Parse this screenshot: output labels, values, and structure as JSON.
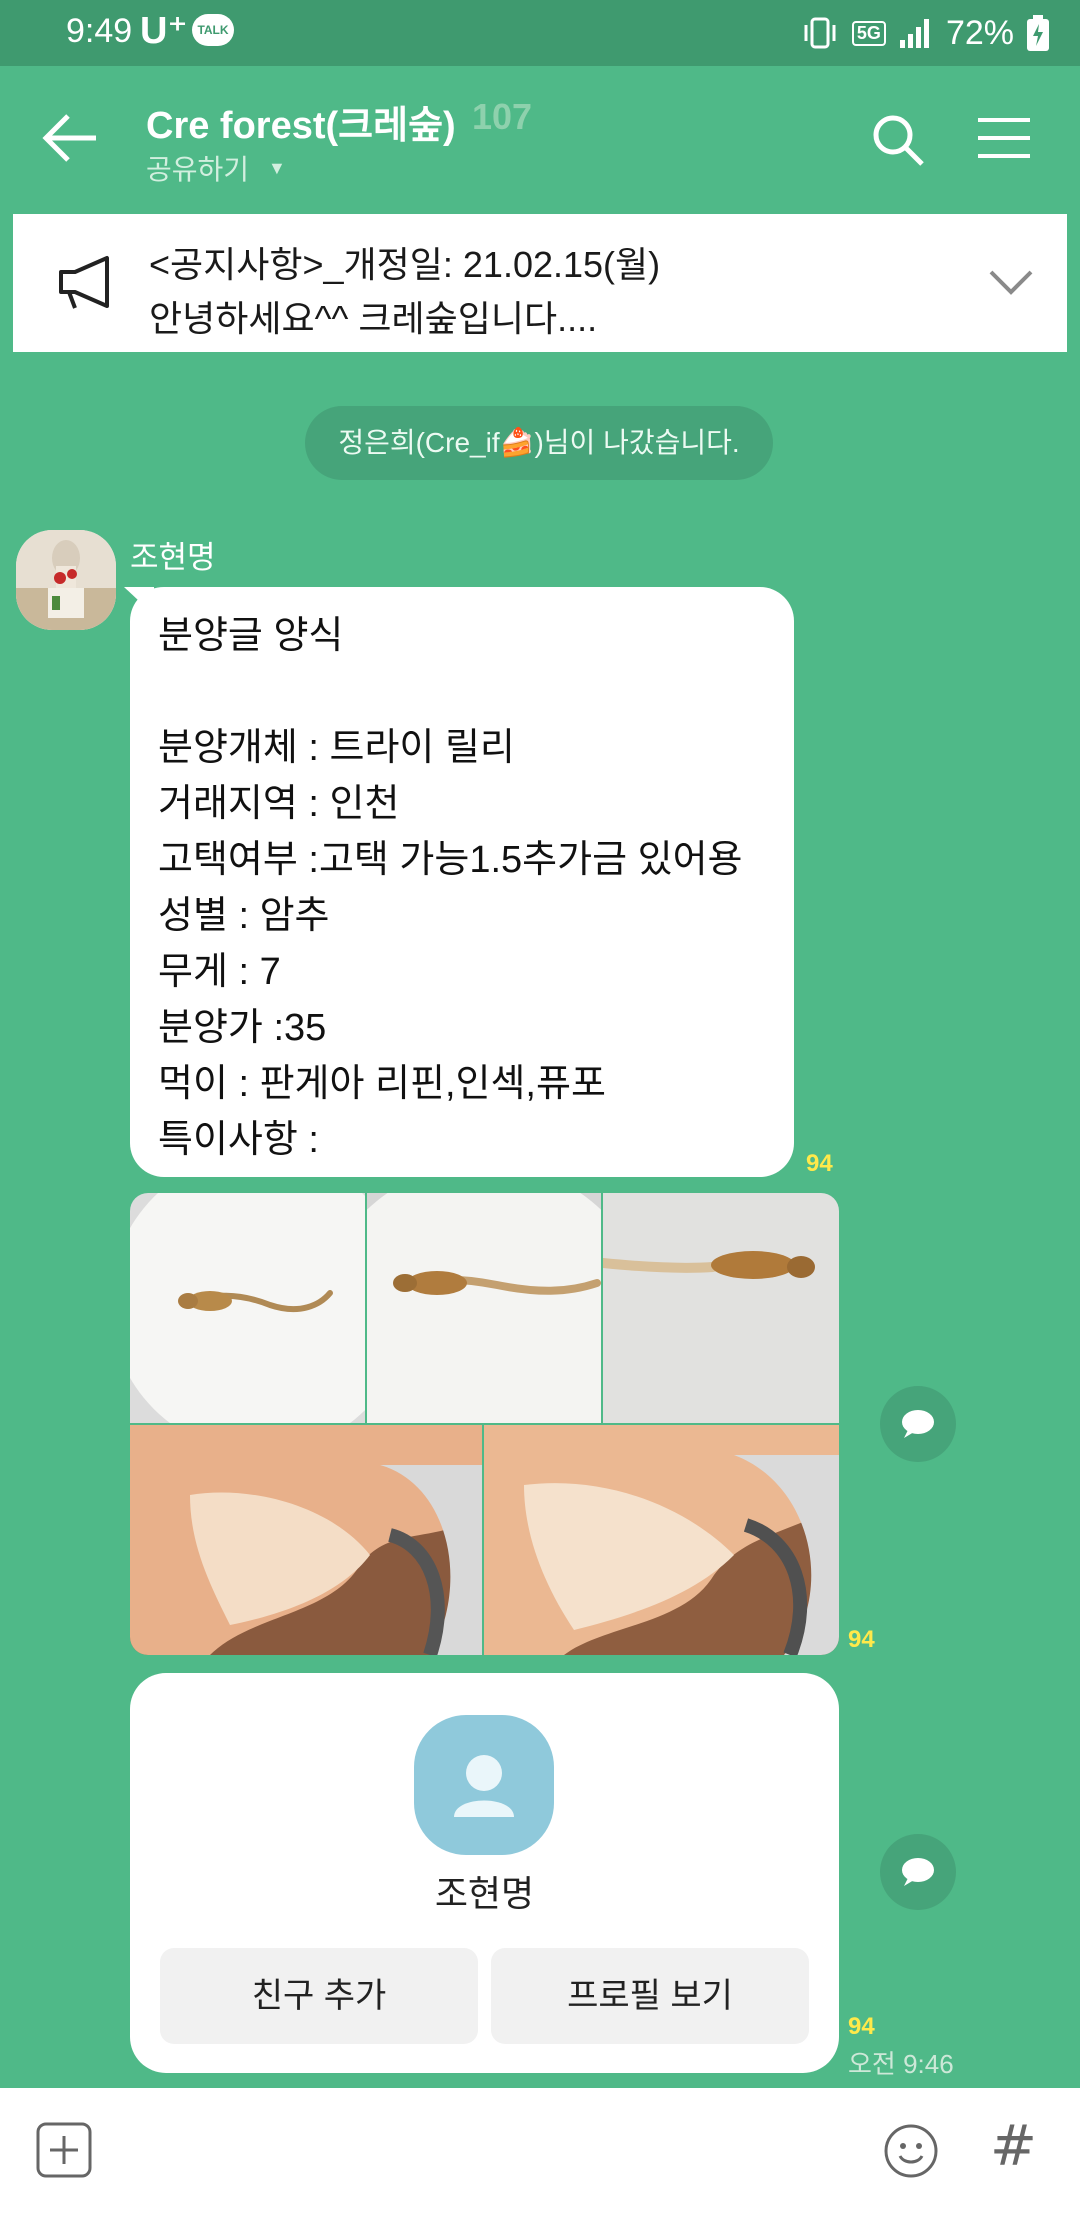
{
  "status_bar": {
    "time": "9:49",
    "carrier": "U⁺",
    "talk_badge": "TALK",
    "network": "5G",
    "battery_percent": "72%",
    "icons": [
      "vibrate-icon",
      "5g-icon",
      "signal-icon",
      "battery-icon"
    ]
  },
  "header": {
    "title": "Cre forest(크레숲)",
    "member_count": "107",
    "share_label": "공유하기",
    "icons": [
      "back-arrow-icon",
      "search-icon",
      "menu-icon"
    ]
  },
  "notice": {
    "line1": "<공지사항>_개정일: 21.02.15(월)",
    "line2": "안녕하세요^^ 크레숲입니다....",
    "icons": [
      "megaphone-icon",
      "chevron-down-icon"
    ]
  },
  "system_message": "정은희(Cre_if🍰)님이 나갔습니다.",
  "message": {
    "sender": "조현명",
    "text": "분양글 양식\n\n분양개체 : 트라이 릴리\n거래지역 : 인천\n고택여부 :고택 가능1.5추가금 있어용\n성별 : 암추\n무게 : 7\n분양가 :35\n먹이 : 판게아 리핀,인섹,퓨포\n특이사항 :",
    "read_count": "94"
  },
  "photo_message": {
    "read_count": "94",
    "photo_count": 5
  },
  "profile_card": {
    "name": "조현명",
    "add_friend_label": "친구 추가",
    "view_profile_label": "프로필 보기",
    "read_count": "94",
    "time": "오전 9:46"
  },
  "input_bar": {
    "icons": [
      "plus-icon",
      "emoji-icon",
      "hashtag-icon"
    ],
    "hash_glyph": "#"
  },
  "colors": {
    "chat_background": "#4fb988",
    "status_bar": "#3f9a6f",
    "read_count": "#ffe94a",
    "profile_avatar": "#8fc9db"
  }
}
